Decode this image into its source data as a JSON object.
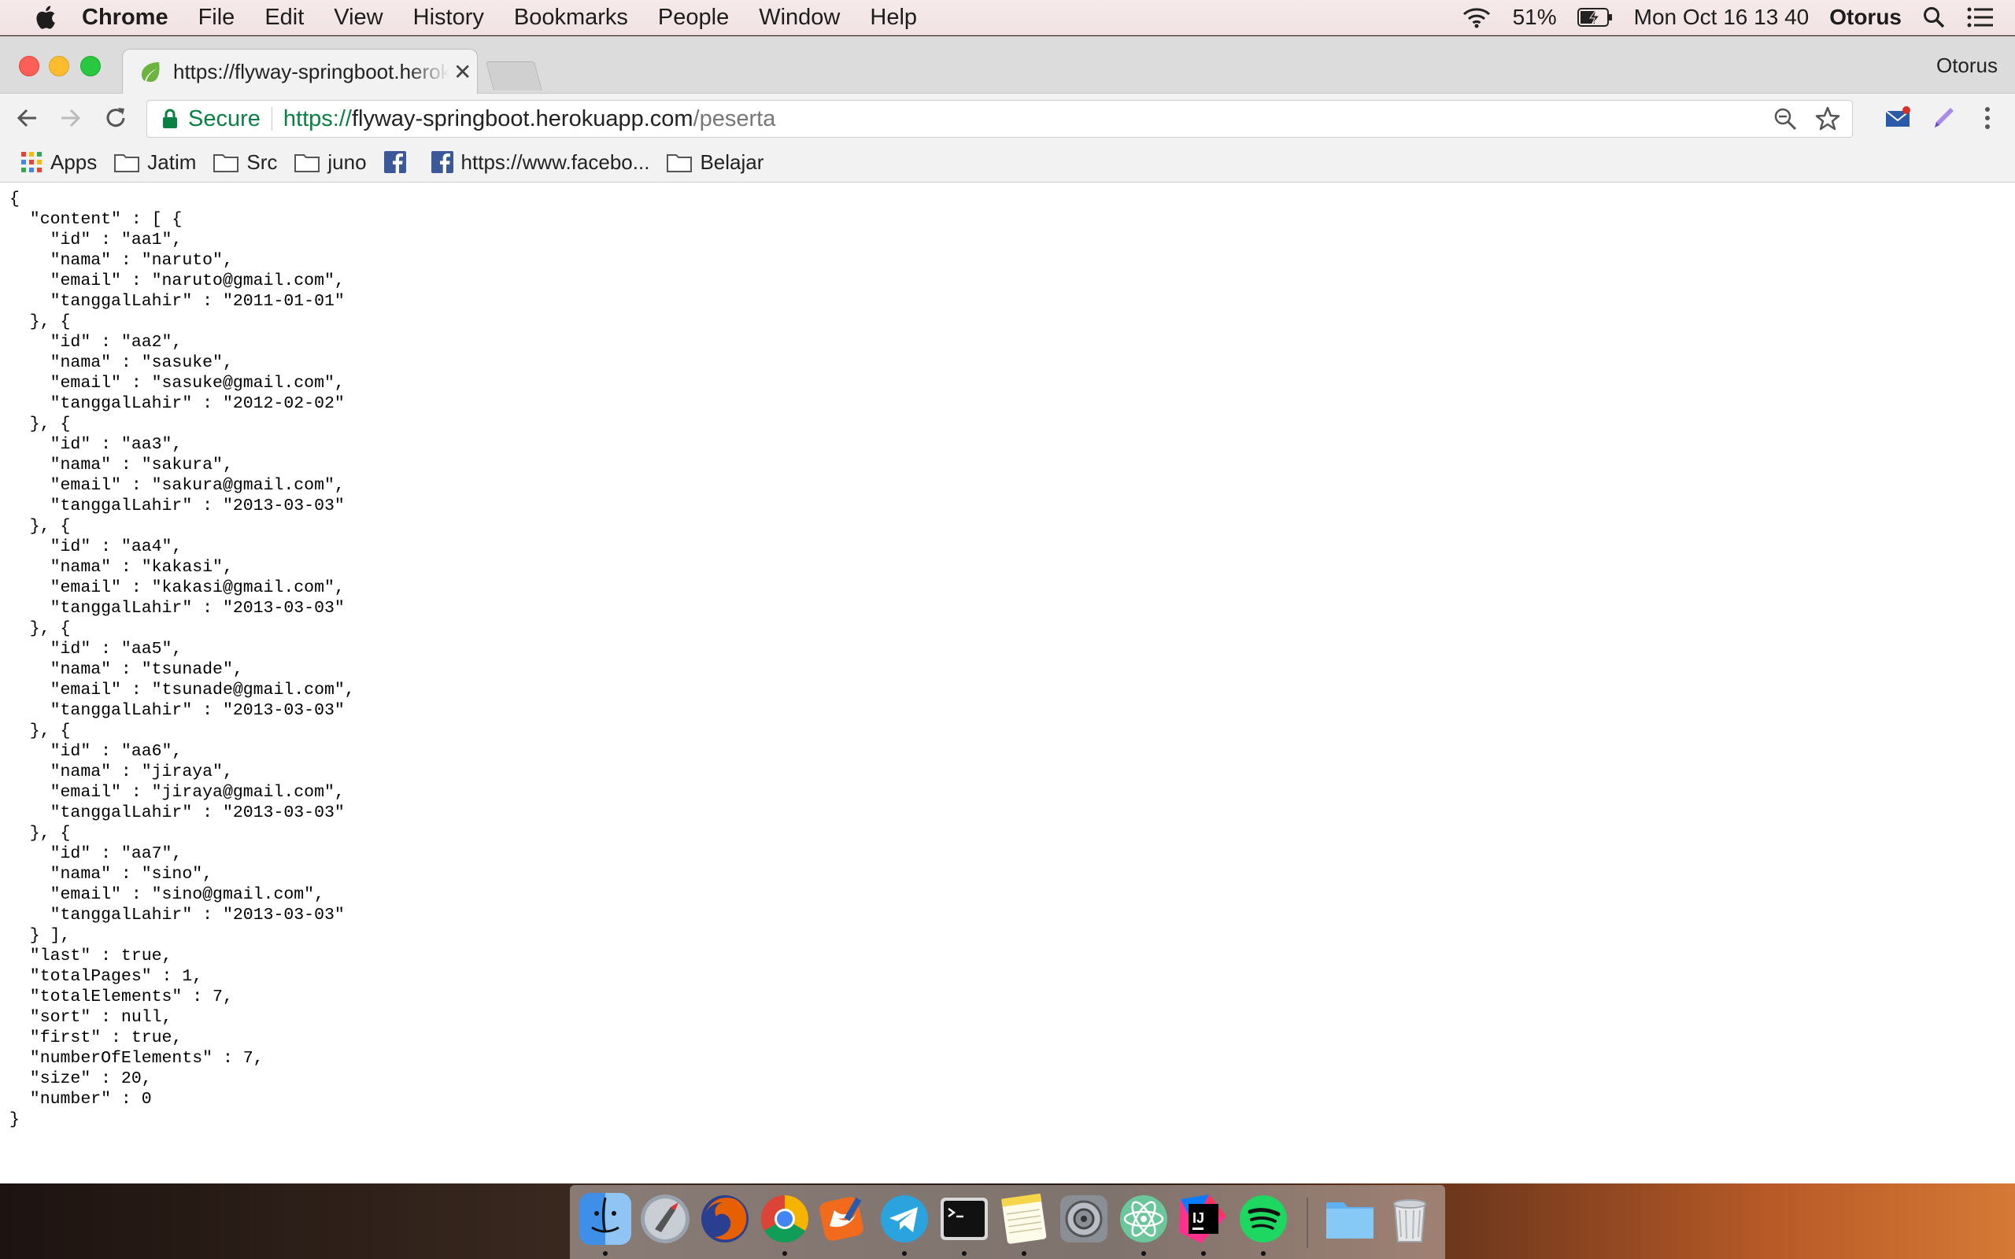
{
  "menubar": {
    "app": "Chrome",
    "items": [
      "File",
      "Edit",
      "View",
      "History",
      "Bookmarks",
      "People",
      "Window",
      "Help"
    ],
    "battery": "51%",
    "datetime": "Mon Oct 16  13 40",
    "user": "Otorus"
  },
  "browser": {
    "tab_title": "https://flyway-springboot.herokuapp.com/peserta",
    "tab_close": "✕",
    "profile": "Otorus",
    "secure_label": "Secure",
    "url_scheme": "https://",
    "url_host": "flyway-springboot.herokuapp.com",
    "url_path": "/peserta",
    "bookmarks": [
      "Apps",
      "Jatim",
      "Src",
      "juno",
      "",
      "https://www.facebo...",
      "Belajar"
    ]
  },
  "page": {
    "json_text": "{\n  \"content\" : [ {\n    \"id\" : \"aa1\",\n    \"nama\" : \"naruto\",\n    \"email\" : \"naruto@gmail.com\",\n    \"tanggalLahir\" : \"2011-01-01\"\n  }, {\n    \"id\" : \"aa2\",\n    \"nama\" : \"sasuke\",\n    \"email\" : \"sasuke@gmail.com\",\n    \"tanggalLahir\" : \"2012-02-02\"\n  }, {\n    \"id\" : \"aa3\",\n    \"nama\" : \"sakura\",\n    \"email\" : \"sakura@gmail.com\",\n    \"tanggalLahir\" : \"2013-03-03\"\n  }, {\n    \"id\" : \"aa4\",\n    \"nama\" : \"kakasi\",\n    \"email\" : \"kakasi@gmail.com\",\n    \"tanggalLahir\" : \"2013-03-03\"\n  }, {\n    \"id\" : \"aa5\",\n    \"nama\" : \"tsunade\",\n    \"email\" : \"tsunade@gmail.com\",\n    \"tanggalLahir\" : \"2013-03-03\"\n  }, {\n    \"id\" : \"aa6\",\n    \"nama\" : \"jiraya\",\n    \"email\" : \"jiraya@gmail.com\",\n    \"tanggalLahir\" : \"2013-03-03\"\n  }, {\n    \"id\" : \"aa7\",\n    \"nama\" : \"sino\",\n    \"email\" : \"sino@gmail.com\",\n    \"tanggalLahir\" : \"2013-03-03\"\n  } ],\n  \"last\" : true,\n  \"totalPages\" : 1,\n  \"totalElements\" : 7,\n  \"sort\" : null,\n  \"first\" : true,\n  \"numberOfElements\" : 7,\n  \"size\" : 20,\n  \"number\" : 0\n}"
  },
  "dock": {
    "apps": [
      "Finder",
      "Launchpad",
      "Firefox",
      "Chrome",
      "Swift Playgrounds",
      "Telegram",
      "Terminal",
      "Notes",
      "System Preferences",
      "Atom",
      "IntelliJ IDEA",
      "Spotify",
      "Downloads",
      "Trash"
    ],
    "colors": {
      "finder": "#3f8ee8",
      "firefox": "#e66000",
      "telegram": "#2aa3df",
      "spotify": "#1ed760",
      "atom": "#6bc79b",
      "intellij": "#1a1a1a"
    }
  }
}
